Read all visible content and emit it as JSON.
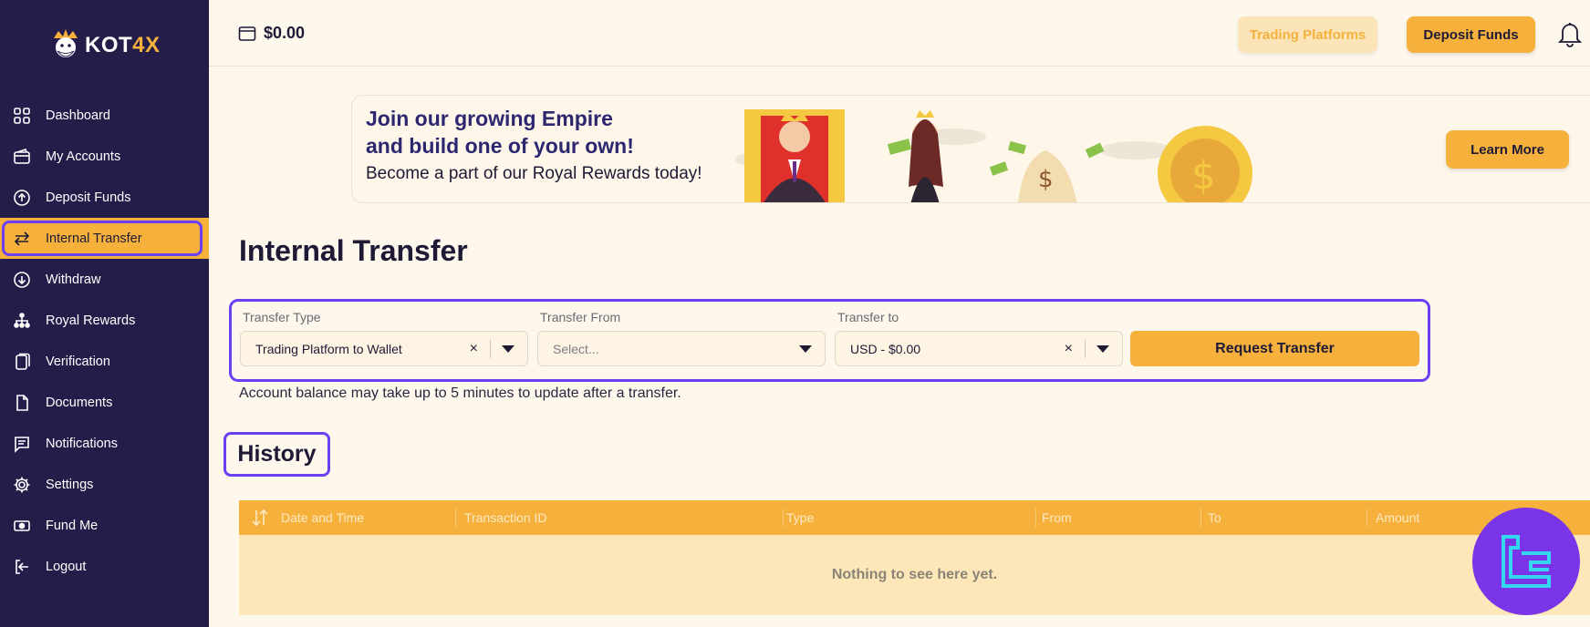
{
  "brand": {
    "logo_text_main": "KOT",
    "logo_text_accent": "4X"
  },
  "sidebar": {
    "items": [
      {
        "label": "Dashboard",
        "icon": "grid-icon"
      },
      {
        "label": "My Accounts",
        "icon": "wallet-icon"
      },
      {
        "label": "Deposit Funds",
        "icon": "arrow-up-circle-icon"
      },
      {
        "label": "Internal Transfer",
        "icon": "transfer-arrows-icon",
        "active": true
      },
      {
        "label": "Withdraw",
        "icon": "arrow-down-circle-icon"
      },
      {
        "label": "Royal Rewards",
        "icon": "hierarchy-icon"
      },
      {
        "label": "Verification",
        "icon": "document-copy-icon"
      },
      {
        "label": "Documents",
        "icon": "file-icon"
      },
      {
        "label": "Notifications",
        "icon": "chat-icon"
      },
      {
        "label": "Settings",
        "icon": "gear-icon"
      },
      {
        "label": "Fund Me",
        "icon": "cash-icon"
      },
      {
        "label": "Logout",
        "icon": "logout-icon"
      }
    ]
  },
  "topbar": {
    "balance": "$0.00",
    "trading_platforms_label": "Trading Platforms",
    "deposit_funds_label": "Deposit Funds"
  },
  "banner": {
    "title_line1": "Join our growing Empire",
    "title_line2": "and build one of your own!",
    "subtitle": "Become a part of our Royal Rewards today!",
    "cta_label": "Learn More"
  },
  "page": {
    "title": "Internal Transfer",
    "note": "Account balance may take up to 5 minutes to update after a transfer."
  },
  "form": {
    "transfer_type_label": "Transfer Type",
    "transfer_type_value": "Trading Platform to Wallet",
    "transfer_from_label": "Transfer From",
    "transfer_from_placeholder": "Select...",
    "transfer_to_label": "Transfer to",
    "transfer_to_value": "USD - $0.00",
    "submit_label": "Request Transfer",
    "clear_glyph": "×"
  },
  "history": {
    "title": "History",
    "columns": [
      "Date and Time",
      "Transaction ID",
      "Type",
      "From",
      "To",
      "Amount"
    ],
    "empty_text": "Nothing to see here yet."
  },
  "colors": {
    "sidebar_bg": "#241d4a",
    "accent": "#f6b13d",
    "highlight": "#6b3ff2",
    "page_bg": "#fdf7ec"
  }
}
